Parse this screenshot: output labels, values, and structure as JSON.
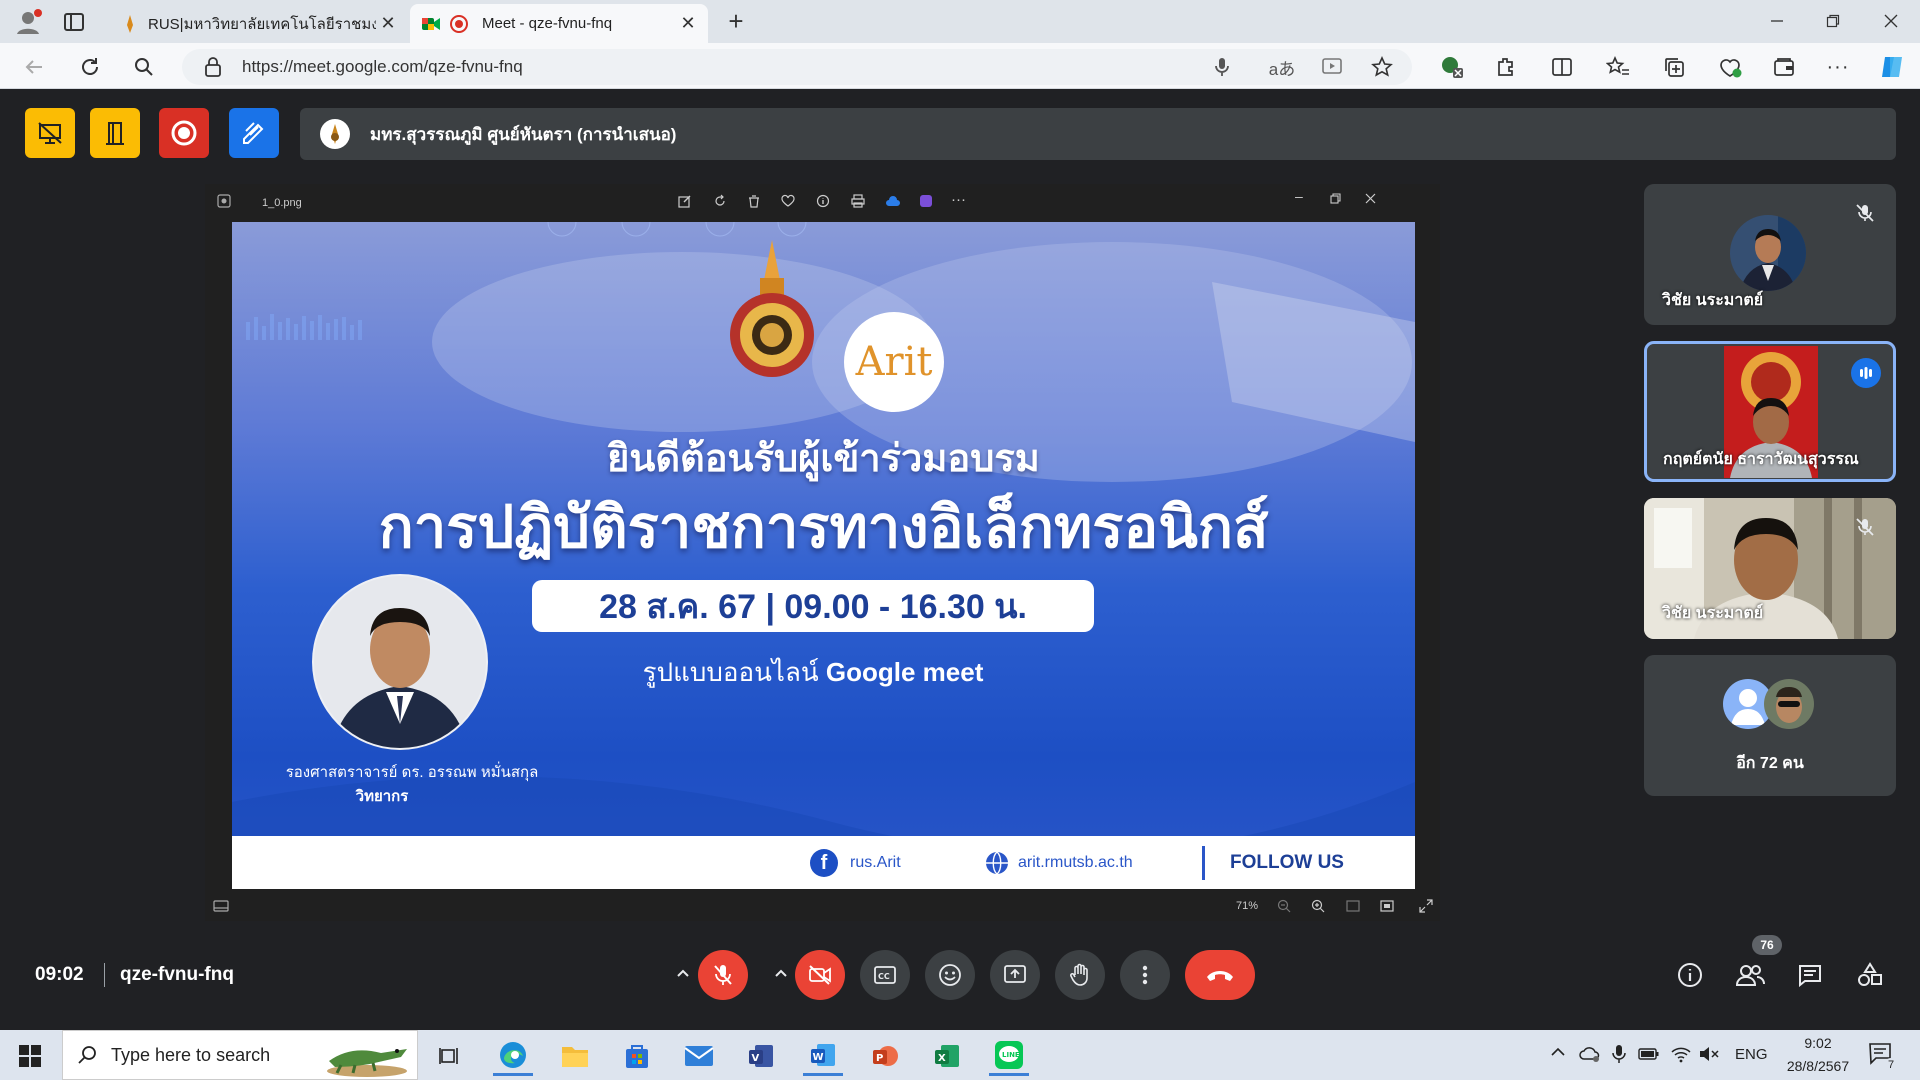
{
  "browser": {
    "tabs": [
      {
        "title": "RUS|มหาวิทยาลัยเทคโนโลยีราชมงคลสุ",
        "active": false
      },
      {
        "title": "Meet - qze-fvnu-fnq",
        "active": true
      }
    ],
    "url": "https://meet.google.com/qze-fvnu-fnq"
  },
  "meet": {
    "presentation_title": "มทร.สุวรรณภูมิ ศูนย์หันตรา (การนำเสนอ)",
    "time": "09:02",
    "meeting_code": "qze-fvnu-fnq",
    "participant_count": "76",
    "viewer": {
      "filename": "1_0.png",
      "zoom": "71%"
    },
    "slide": {
      "logo_text": "Arit",
      "welcome": "ยินดีต้อนรับผู้เข้าร่วมอบรม",
      "headline": "การปฏิบัติราชการทางอิเล็กทรอนิกส์",
      "datetime": "28 ส.ค. 67 | 09.00 - 16.30 น.",
      "format_prefix": "รูปแบบออนไลน์ ",
      "format_platform": "Google meet",
      "speaker_name": "รองศาสตราจารย์ ดร. อรรณพ หมั่นสกุล",
      "speaker_role": "วิทยากร",
      "facebook": "rus.Arit",
      "website": "arit.rmutsb.ac.th",
      "follow": "FOLLOW US"
    },
    "participants": [
      {
        "name": "วิชัย นระมาตย์",
        "muted": true
      },
      {
        "name": "กฤตย์ตนัย ธาราวัฒนสุวรรณ",
        "speaking": true
      },
      {
        "name": "วิชัย นระมาตย์",
        "muted": true
      },
      {
        "name": "อีก 72 คน"
      }
    ],
    "colors": {
      "end_call": "#ea4335",
      "accent": "#8ab4f8",
      "recording": "#d93025",
      "yellow_btn": "#fbbc04",
      "blue_btn": "#1a73e8"
    }
  },
  "taskbar": {
    "search_placeholder": "Type here to search",
    "language": "ENG",
    "clock_time": "9:02",
    "clock_date": "28/8/2567",
    "notification_count": "7"
  }
}
